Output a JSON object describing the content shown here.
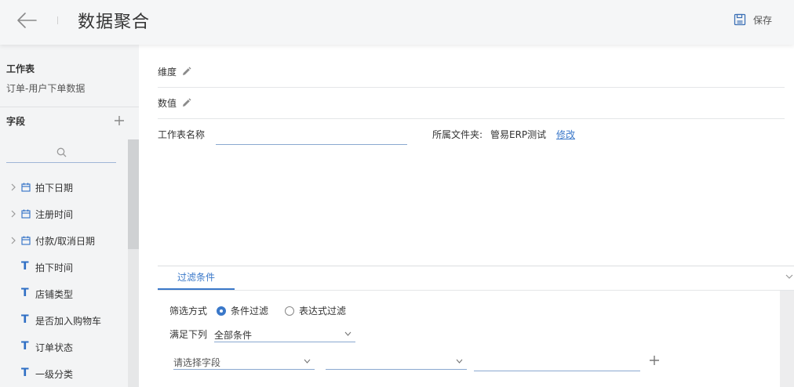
{
  "header": {
    "title": "数据聚合",
    "save_label": "保存",
    "back_icon": "arrow-left-icon",
    "save_icon": "save-icon"
  },
  "sidebar": {
    "worksheet_label": "工作表",
    "worksheet_name": "订单-用户下单数据",
    "fields_label": "字段",
    "search_placeholder": "",
    "fields": [
      {
        "label": "拍下日期",
        "type": "date",
        "expandable": true
      },
      {
        "label": "注册时间",
        "type": "date",
        "expandable": true
      },
      {
        "label": "付款/取消日期",
        "type": "date",
        "expandable": true
      },
      {
        "label": "拍下时间",
        "type": "text",
        "expandable": false
      },
      {
        "label": "店铺类型",
        "type": "text",
        "expandable": false
      },
      {
        "label": "是否加入购物车",
        "type": "text",
        "expandable": false
      },
      {
        "label": "订单状态",
        "type": "text",
        "expandable": false
      },
      {
        "label": "一级分类",
        "type": "text",
        "expandable": false
      }
    ]
  },
  "main": {
    "dimension_label": "维度",
    "value_label": "数值",
    "worksheet_name_label": "工作表名称",
    "worksheet_name_value": "",
    "folder_label": "所属文件夹:",
    "folder_name": "管易ERP测试",
    "modify_link": "修改"
  },
  "filter": {
    "tab_label": "过滤条件",
    "mode_label": "筛选方式",
    "mode_condition": "条件过滤",
    "mode_expression": "表达式过滤",
    "meet_label": "满足下列",
    "meet_value": "全部条件",
    "field_select": "请选择字段",
    "operator_select": "",
    "value_input": ""
  },
  "colors": {
    "accent": "#3a78c9",
    "sidebar_bg": "#f3f4f5",
    "header_bg": "#f5f6f7"
  }
}
